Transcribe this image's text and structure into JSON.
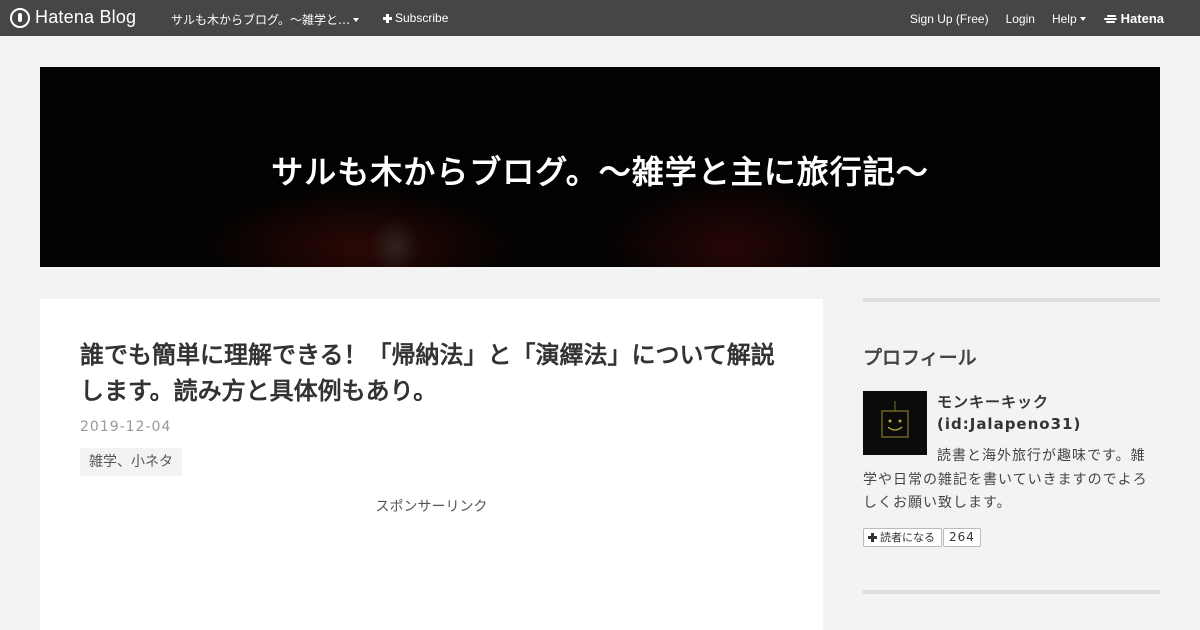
{
  "topbar": {
    "logo_text": "Hatena Blog",
    "blog_name": "サルも木からブログ。〜雑学と…",
    "subscribe": "Subscribe",
    "signup": "Sign Up (Free)",
    "login": "Login",
    "help": "Help",
    "hatena": "Hatena"
  },
  "header": {
    "blog_title": "サルも木からブログ。〜雑学と主に旅行記〜"
  },
  "article": {
    "title": "誰でも簡単に理解できる！「帰納法」と「演繹法」について解説します。読み方と具体例もあり。",
    "date": "2019-12-04",
    "category": "雑学、小ネタ",
    "sponsor_label": "スポンサーリンク"
  },
  "sidebar": {
    "profile_heading": "プロフィール",
    "name_line1": "モンキーキック",
    "name_line2": "(id:Jalapeno31)",
    "description_line1": "読書と海外旅行が趣味です。雑",
    "description_rest": "学や日常の雑記を書いていきますのでよろしくお願い致します。",
    "reader_button": "読者になる",
    "reader_count": "264"
  },
  "colors": {
    "topbar_bg": "#464646",
    "page_bg": "#f3f3f3",
    "banner_bg": "#020202"
  }
}
